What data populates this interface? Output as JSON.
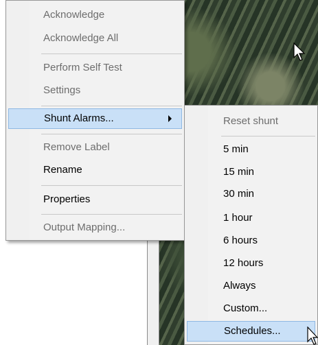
{
  "context_menu": {
    "items": [
      {
        "label": "Acknowledge",
        "disabled": true
      },
      {
        "label": "Acknowledge All",
        "disabled": true
      },
      {
        "label": "Perform Self Test",
        "disabled": true
      },
      {
        "label": "Settings",
        "disabled": true
      },
      {
        "label": "Shunt Alarms...",
        "disabled": false,
        "highlighted": true,
        "has_submenu": true
      },
      {
        "label": "Remove Label",
        "disabled": true
      },
      {
        "label": "Rename",
        "disabled": false
      },
      {
        "label": "Properties",
        "disabled": false
      },
      {
        "label": "Output Mapping...",
        "disabled": true
      }
    ]
  },
  "shunt_submenu": {
    "items": [
      {
        "label": "Reset shunt",
        "disabled": true
      },
      {
        "label": "5 min",
        "disabled": false
      },
      {
        "label": "15 min",
        "disabled": false
      },
      {
        "label": "30 min",
        "disabled": false
      },
      {
        "label": "1 hour",
        "disabled": false
      },
      {
        "label": "6 hours",
        "disabled": false
      },
      {
        "label": "12 hours",
        "disabled": false
      },
      {
        "label": "Always",
        "disabled": false
      },
      {
        "label": "Custom...",
        "disabled": false
      },
      {
        "label": "Schedules...",
        "disabled": false,
        "highlighted": true
      }
    ]
  },
  "colors": {
    "menu_bg": "#f2f2f2",
    "highlight_bg": "#c9e0f7",
    "highlight_border": "#8fb8e3",
    "disabled_text": "#6d6d6d"
  },
  "icons": [
    "submenu-arrow-icon",
    "mouse-pointer-icon"
  ]
}
